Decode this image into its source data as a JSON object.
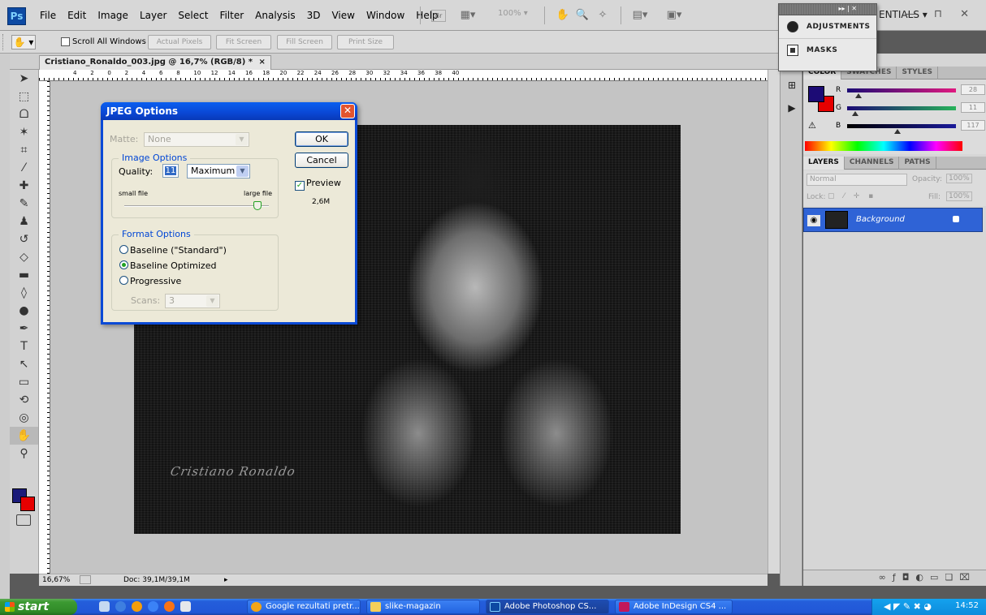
{
  "app": {
    "logo": "Ps",
    "menus": [
      "File",
      "Edit",
      "Image",
      "Layer",
      "Select",
      "Filter",
      "Analysis",
      "3D",
      "View",
      "Window",
      "Help"
    ],
    "zoom_combo": "100%",
    "workspace": "ENTIALS",
    "window_controls": "— ⊓ ✕"
  },
  "adjustments_popup": {
    "items": [
      {
        "label": "ADJUSTMENTS",
        "icon": "adjustments-icon"
      },
      {
        "label": "MASKS",
        "icon": "masks-icon"
      }
    ]
  },
  "options_bar": {
    "scroll_all_windows": "Scroll All Windows",
    "buttons": [
      "Actual Pixels",
      "Fit Screen",
      "Fill Screen",
      "Print Size"
    ]
  },
  "document": {
    "tab_title": "Cristiano_Ronaldo_003.jpg @ 16,7% (RGB/8) *",
    "tab_close": "×",
    "ruler_labels": [
      "4",
      "2",
      "0",
      "2",
      "4",
      "6",
      "8",
      "10",
      "12",
      "14",
      "16",
      "18",
      "20",
      "22",
      "24",
      "26",
      "28",
      "30",
      "32",
      "34",
      "36",
      "38",
      "40"
    ],
    "photo_signature": "Cristiano Ronaldo"
  },
  "status_bar": {
    "zoom": "16,67%",
    "doc_size": "Doc: 39,1M/39,1M"
  },
  "color_panel": {
    "tabs": [
      "COLOR",
      "SWATCHES",
      "STYLES"
    ],
    "active_tab": "COLOR",
    "channels": [
      {
        "label": "R",
        "value": "28",
        "color": "#e0197f"
      },
      {
        "label": "G",
        "value": "11",
        "color": "#27b35a"
      },
      {
        "label": "B",
        "value": "117",
        "color": "#1a1a9a"
      }
    ],
    "foreground": "#1c0b75",
    "background": "#e60000"
  },
  "layers_panel": {
    "tabs": [
      "LAYERS",
      "CHANNELS",
      "PATHS"
    ],
    "active_tab": "LAYERS",
    "blend_mode": "Normal",
    "opacity_label": "Opacity:",
    "opacity_value": "100%",
    "lock_label": "Lock:",
    "fill_label": "Fill:",
    "fill_value": "100%",
    "layers": [
      {
        "name": "Background",
        "selected": true
      }
    ]
  },
  "dialog": {
    "title": "JPEG Options",
    "matte_label": "Matte:",
    "matte_value": "None",
    "image_options_legend": "Image Options",
    "quality_label": "Quality:",
    "quality_value": "11",
    "quality_preset": "Maximum",
    "small_file": "small file",
    "large_file": "large file",
    "quality_slider_fraction": 0.92,
    "format_options_legend": "Format Options",
    "formats": [
      {
        "label": "Baseline (\"Standard\")",
        "selected": false
      },
      {
        "label": "Baseline Optimized",
        "selected": true
      },
      {
        "label": "Progressive",
        "selected": false
      }
    ],
    "scans_label": "Scans:",
    "scans_value": "3",
    "ok_label": "OK",
    "cancel_label": "Cancel",
    "preview_label": "Preview",
    "preview_checked": true,
    "file_size": "2,6M"
  },
  "taskbar": {
    "start_label": "start",
    "tasks": [
      {
        "label": "Google rezultati pretr...",
        "icon_color": "#f2a516",
        "active": false
      },
      {
        "label": "slike-magazin",
        "icon_color": "#f5cf5a",
        "active": false
      },
      {
        "label": "Adobe Photoshop CS...",
        "icon_color": "#0d4aa3",
        "active": true
      },
      {
        "label": "Adobe InDesign CS4 ...",
        "icon_color": "#c2185b",
        "active": false
      }
    ],
    "clock": "14:52"
  }
}
